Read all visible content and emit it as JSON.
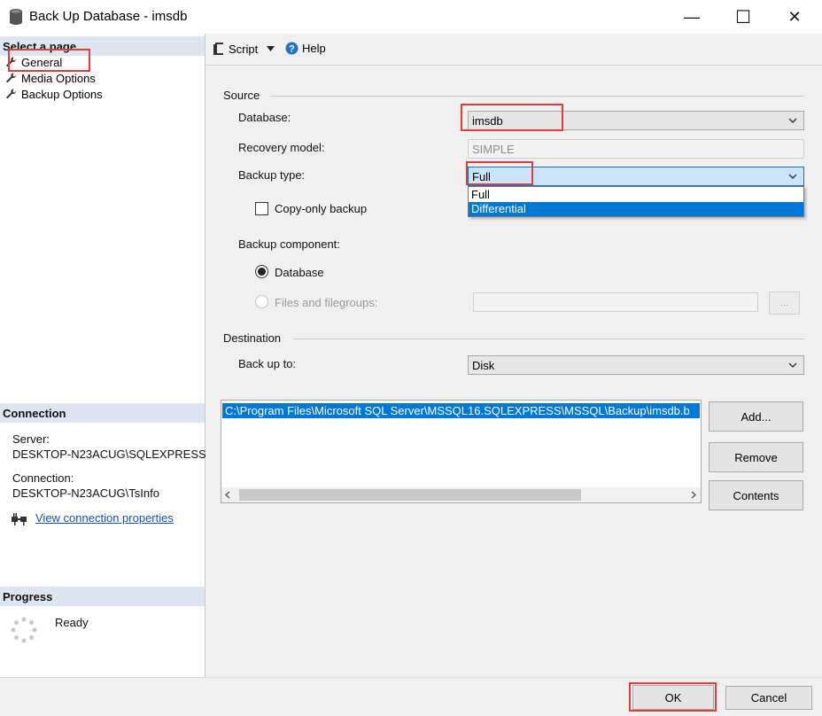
{
  "window": {
    "title": "Back Up Database - imsdb",
    "minimize_glyph": "—",
    "maximize_glyph": "☐",
    "close_glyph": "✕"
  },
  "sidebar": {
    "select_page_label": "Select a page",
    "pages": [
      {
        "label": "General",
        "icon": "wrench-icon"
      },
      {
        "label": "Media Options",
        "icon": "wrench-icon"
      },
      {
        "label": "Backup Options",
        "icon": "wrench-icon"
      }
    ],
    "connection": {
      "header": "Connection",
      "server_label": "Server:",
      "server_value": "DESKTOP-N23ACUG\\SQLEXPRESS",
      "connection_label": "Connection:",
      "connection_value": "DESKTOP-N23ACUG\\TsInfo",
      "view_link": "View connection properties"
    },
    "progress": {
      "header": "Progress",
      "status": "Ready"
    }
  },
  "toolbar": {
    "script_label": "Script",
    "help_label": "Help"
  },
  "source": {
    "legend": "Source",
    "database_label": "Database:",
    "database_value": "imsdb",
    "recovery_label": "Recovery model:",
    "recovery_value": "SIMPLE",
    "backup_type_label": "Backup type:",
    "backup_type_value": "Full",
    "backup_type_options": [
      "Full",
      "Differential"
    ],
    "copy_only_label": "Copy-only backup",
    "component_label": "Backup component:",
    "component_database": "Database",
    "component_files": "Files and filegroups:",
    "ellipsis_label": "..."
  },
  "destination": {
    "legend": "Destination",
    "backup_to_label": "Back up to:",
    "backup_to_value": "Disk",
    "paths": [
      "C:\\Program Files\\Microsoft SQL Server\\MSSQL16.SQLEXPRESS\\MSSQL\\Backup\\imsdb.b"
    ],
    "add_label": "Add...",
    "remove_label": "Remove",
    "contents_label": "Contents"
  },
  "footer": {
    "ok_label": "OK",
    "cancel_label": "Cancel"
  },
  "colors": {
    "selection": "#0078d7",
    "highlight_box": "#e03c3c",
    "section_header": "#dde6f0",
    "link": "#1a4dbe"
  }
}
